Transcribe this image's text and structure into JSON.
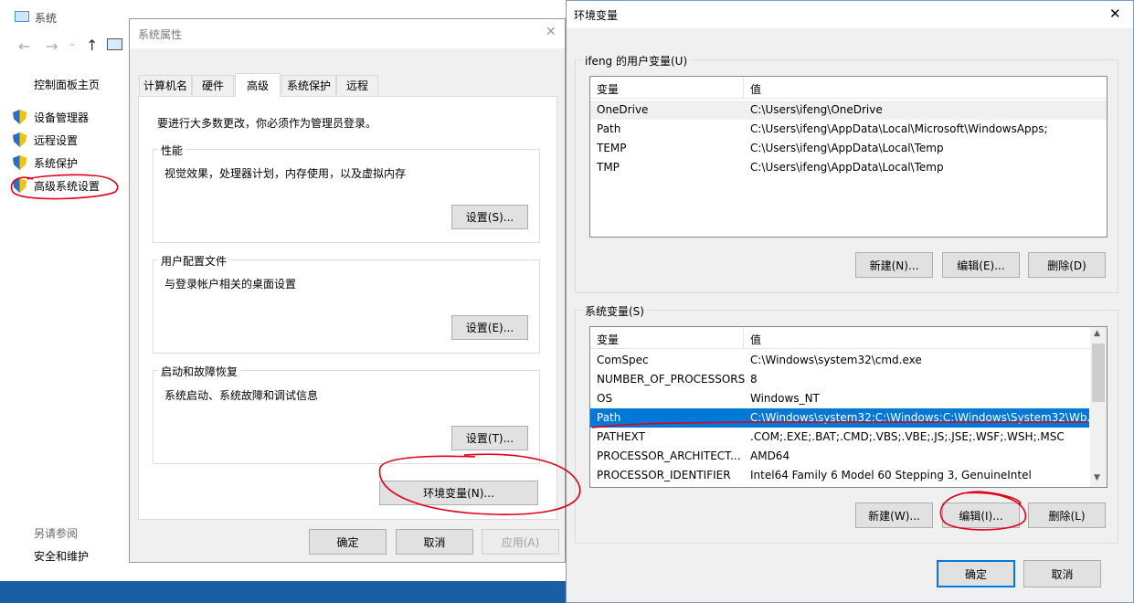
{
  "system_window": {
    "title": "系统",
    "nav": {
      "back": "←",
      "forward": "→",
      "up": "↑"
    },
    "control_panel_home": "控制面板主页",
    "links": [
      "设备管理器",
      "远程设置",
      "系统保护",
      "高级系统设置"
    ],
    "see_also_label": "另请参阅",
    "see_also_link": "安全和维护"
  },
  "sys_props": {
    "title": "系统属性",
    "tabs": [
      "计算机名",
      "硬件",
      "高级",
      "系统保护",
      "远程"
    ],
    "active_tab": "高级",
    "admin_notice": "要进行大多数更改，你必须作为管理员登录。",
    "performance": {
      "title": "性能",
      "desc": "视觉效果，处理器计划，内存使用，以及虚拟内存",
      "button": "设置(S)..."
    },
    "user_profiles": {
      "title": "用户配置文件",
      "desc": "与登录帐户相关的桌面设置",
      "button": "设置(E)..."
    },
    "startup": {
      "title": "启动和故障恢复",
      "desc": "系统启动、系统故障和调试信息",
      "button": "设置(T)..."
    },
    "env_button": "环境变量(N)...",
    "ok": "确定",
    "cancel": "取消",
    "apply": "应用(A)"
  },
  "env_vars": {
    "title": "环境变量",
    "user_section": "ifeng 的用户变量(U)",
    "col_var": "变量",
    "col_val": "值",
    "user_rows": [
      {
        "name": "OneDrive",
        "value": "C:\\Users\\ifeng\\OneDrive"
      },
      {
        "name": "Path",
        "value": "C:\\Users\\ifeng\\AppData\\Local\\Microsoft\\WindowsApps;"
      },
      {
        "name": "TEMP",
        "value": "C:\\Users\\ifeng\\AppData\\Local\\Temp"
      },
      {
        "name": "TMP",
        "value": "C:\\Users\\ifeng\\AppData\\Local\\Temp"
      }
    ],
    "user_buttons": {
      "new": "新建(N)...",
      "edit": "编辑(E)...",
      "delete": "删除(D)"
    },
    "sys_section": "系统变量(S)",
    "sys_rows": [
      {
        "name": "ComSpec",
        "value": "C:\\Windows\\system32\\cmd.exe"
      },
      {
        "name": "NUMBER_OF_PROCESSORS",
        "value": "8"
      },
      {
        "name": "OS",
        "value": "Windows_NT"
      },
      {
        "name": "Path",
        "value": "C:\\Windows\\system32;C:\\Windows;C:\\Windows\\System32\\Wb..."
      },
      {
        "name": "PATHEXT",
        "value": ".COM;.EXE;.BAT;.CMD;.VBS;.VBE;.JS;.JSE;.WSF;.WSH;.MSC"
      },
      {
        "name": "PROCESSOR_ARCHITECT...",
        "value": "AMD64"
      },
      {
        "name": "PROCESSOR_IDENTIFIER",
        "value": "Intel64 Family 6 Model 60 Stepping 3, GenuineIntel"
      }
    ],
    "sys_selected_index": 3,
    "sys_buttons": {
      "new": "新建(W)...",
      "edit": "编辑(I)...",
      "delete": "删除(L)"
    },
    "ok": "确定",
    "cancel": "取消",
    "close": "✕"
  },
  "colors": {
    "selection": "#0078d7",
    "annotation": "#e0001b"
  }
}
